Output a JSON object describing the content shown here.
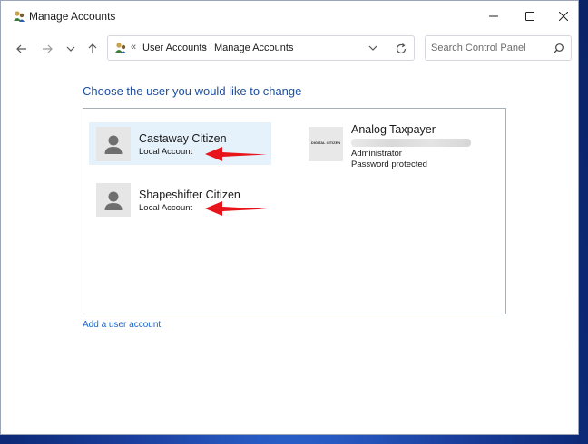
{
  "window": {
    "title": "Manage Accounts"
  },
  "navigation": {
    "breadcrumbs": [
      "User Accounts",
      "Manage Accounts"
    ],
    "overflow_chevron": "«",
    "separator": "›",
    "search_placeholder": "Search Control Panel"
  },
  "main": {
    "heading": "Choose the user you would like to change",
    "accounts": [
      {
        "name": "Castaway Citizen",
        "type": "Local Account",
        "selected": true,
        "icon": "person-avatar-icon"
      },
      {
        "name": "Shapeshifter Citizen",
        "type": "Local Account",
        "selected": false,
        "icon": "person-avatar-icon"
      },
      {
        "name": "Analog Taxpayer",
        "line1": "Administrator",
        "line2": "Password protected",
        "icon": "digital-citizen-logo",
        "logo_text": "DIGITAL CITIZEN"
      }
    ],
    "add_user_link": "Add a user account"
  },
  "colors": {
    "accent": "#1e4fa0",
    "link": "#1a63c9",
    "selection": "#e5f1fb",
    "annotation_arrow": "#e8141b"
  }
}
